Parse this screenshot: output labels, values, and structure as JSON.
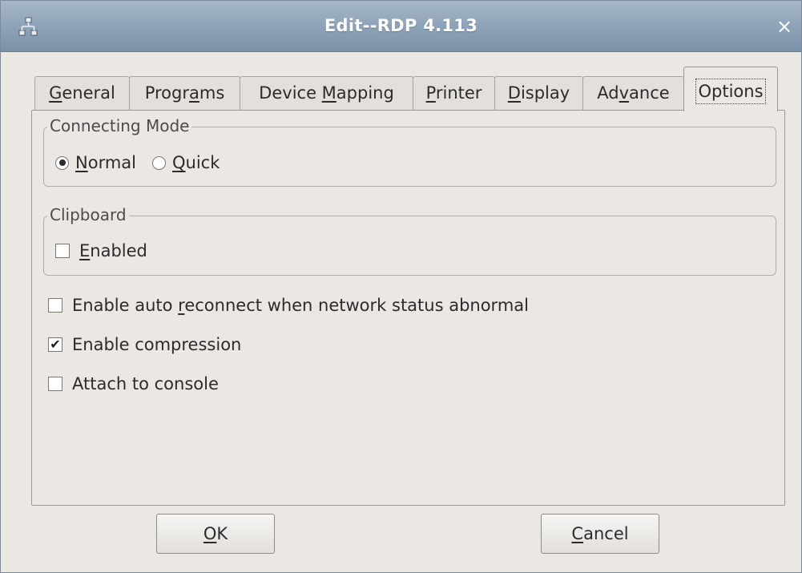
{
  "window": {
    "title": "Edit--RDP 4.113",
    "close_glyph": "×",
    "app_icon": "network-icon"
  },
  "tabs": [
    {
      "pre": "",
      "mn": "G",
      "post": "eneral",
      "active": false
    },
    {
      "pre": "Progr",
      "mn": "a",
      "post": "ms",
      "active": false
    },
    {
      "pre": "Device ",
      "mn": "M",
      "post": "apping",
      "active": false
    },
    {
      "pre": "",
      "mn": "P",
      "post": "rinter",
      "active": false
    },
    {
      "pre": "",
      "mn": "D",
      "post": "isplay",
      "active": false
    },
    {
      "pre": "Ad",
      "mn": "v",
      "post": "ance",
      "active": false
    },
    {
      "pre": "",
      "mn": "",
      "post": "Options",
      "active": true
    }
  ],
  "connecting_mode": {
    "legend": "Connecting Mode",
    "selected": "Normal",
    "options": [
      {
        "pre": "",
        "mn": "N",
        "post": "ormal",
        "checked": true
      },
      {
        "pre": "",
        "mn": "Q",
        "post": "uick",
        "checked": false
      }
    ]
  },
  "clipboard": {
    "legend": "Clipboard",
    "enabled": {
      "pre": "",
      "mn": "E",
      "post": "nabled",
      "checked": false
    }
  },
  "options": [
    {
      "pre": "Enable auto ",
      "mn": "r",
      "post": "econnect when network status abnormal",
      "checked": false
    },
    {
      "pre": "Enable compression",
      "mn": "",
      "post": "",
      "checked": true
    },
    {
      "pre": "Attach to console",
      "mn": "",
      "post": "",
      "checked": false
    }
  ],
  "buttons": {
    "ok": {
      "pre": "",
      "mn": "O",
      "post": "K"
    },
    "cancel": {
      "pre": "",
      "mn": "C",
      "post": "ancel"
    }
  },
  "check_glyph": "✔"
}
